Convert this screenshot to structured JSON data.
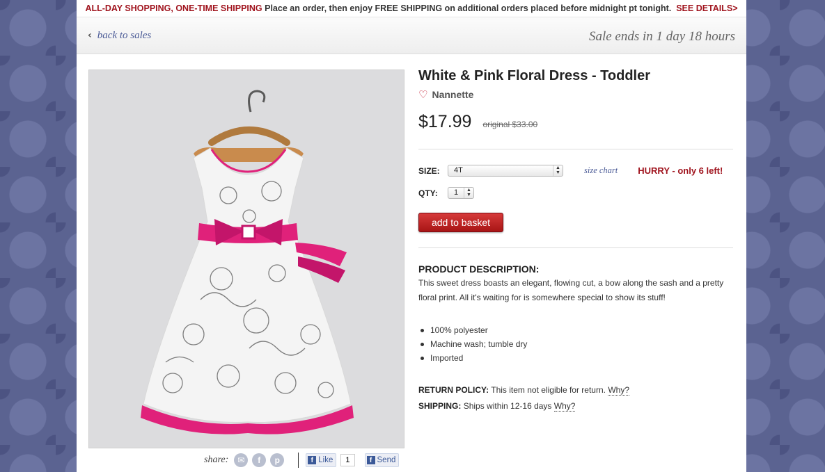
{
  "promo": {
    "lead": "ALL-DAY SHOPPING, ONE-TIME SHIPPING",
    "text": "Place an order, then enjoy",
    "free": "FREE SHIPPING",
    "tail": "on additional orders placed before midnight pt tonight.",
    "link": "SEE DETAILS>"
  },
  "nav": {
    "back_label": "back to sales",
    "sale_ends": "Sale ends in 1 day 18 hours"
  },
  "product": {
    "title": "White & Pink Floral Dress - Toddler",
    "brand": "Nannette",
    "price": "$17.99",
    "original": "original $33.00",
    "size_label": "SIZE:",
    "size_value": "4T",
    "size_chart": "size chart",
    "hurry": "HURRY - only 6 left!",
    "qty_label": "QTY:",
    "qty_value": "1",
    "add_button": "add to basket"
  },
  "description": {
    "heading": "PRODUCT DESCRIPTION:",
    "body": "This sweet dress boasts an elegant, flowing cut, a bow along the sash and a pretty floral print. All it's waiting for is somewhere special to show its stuff!",
    "bullets": [
      "100% polyester",
      "Machine wash; tumble dry",
      "Imported"
    ],
    "return_label": "RETURN POLICY:",
    "return_text": "This item not eligible for return.",
    "shipping_label": "SHIPPING:",
    "shipping_text": "Ships within 12-16 days",
    "why": "Why?"
  },
  "share": {
    "label": "share:",
    "icons": [
      "email-icon",
      "facebook-icon",
      "pinterest-icon"
    ],
    "like": "Like",
    "like_count": "1",
    "send": "Send"
  },
  "colors": {
    "accent_red": "#a0141e",
    "link_blue": "#4a5a96",
    "dress_pink": "#e0217a"
  }
}
